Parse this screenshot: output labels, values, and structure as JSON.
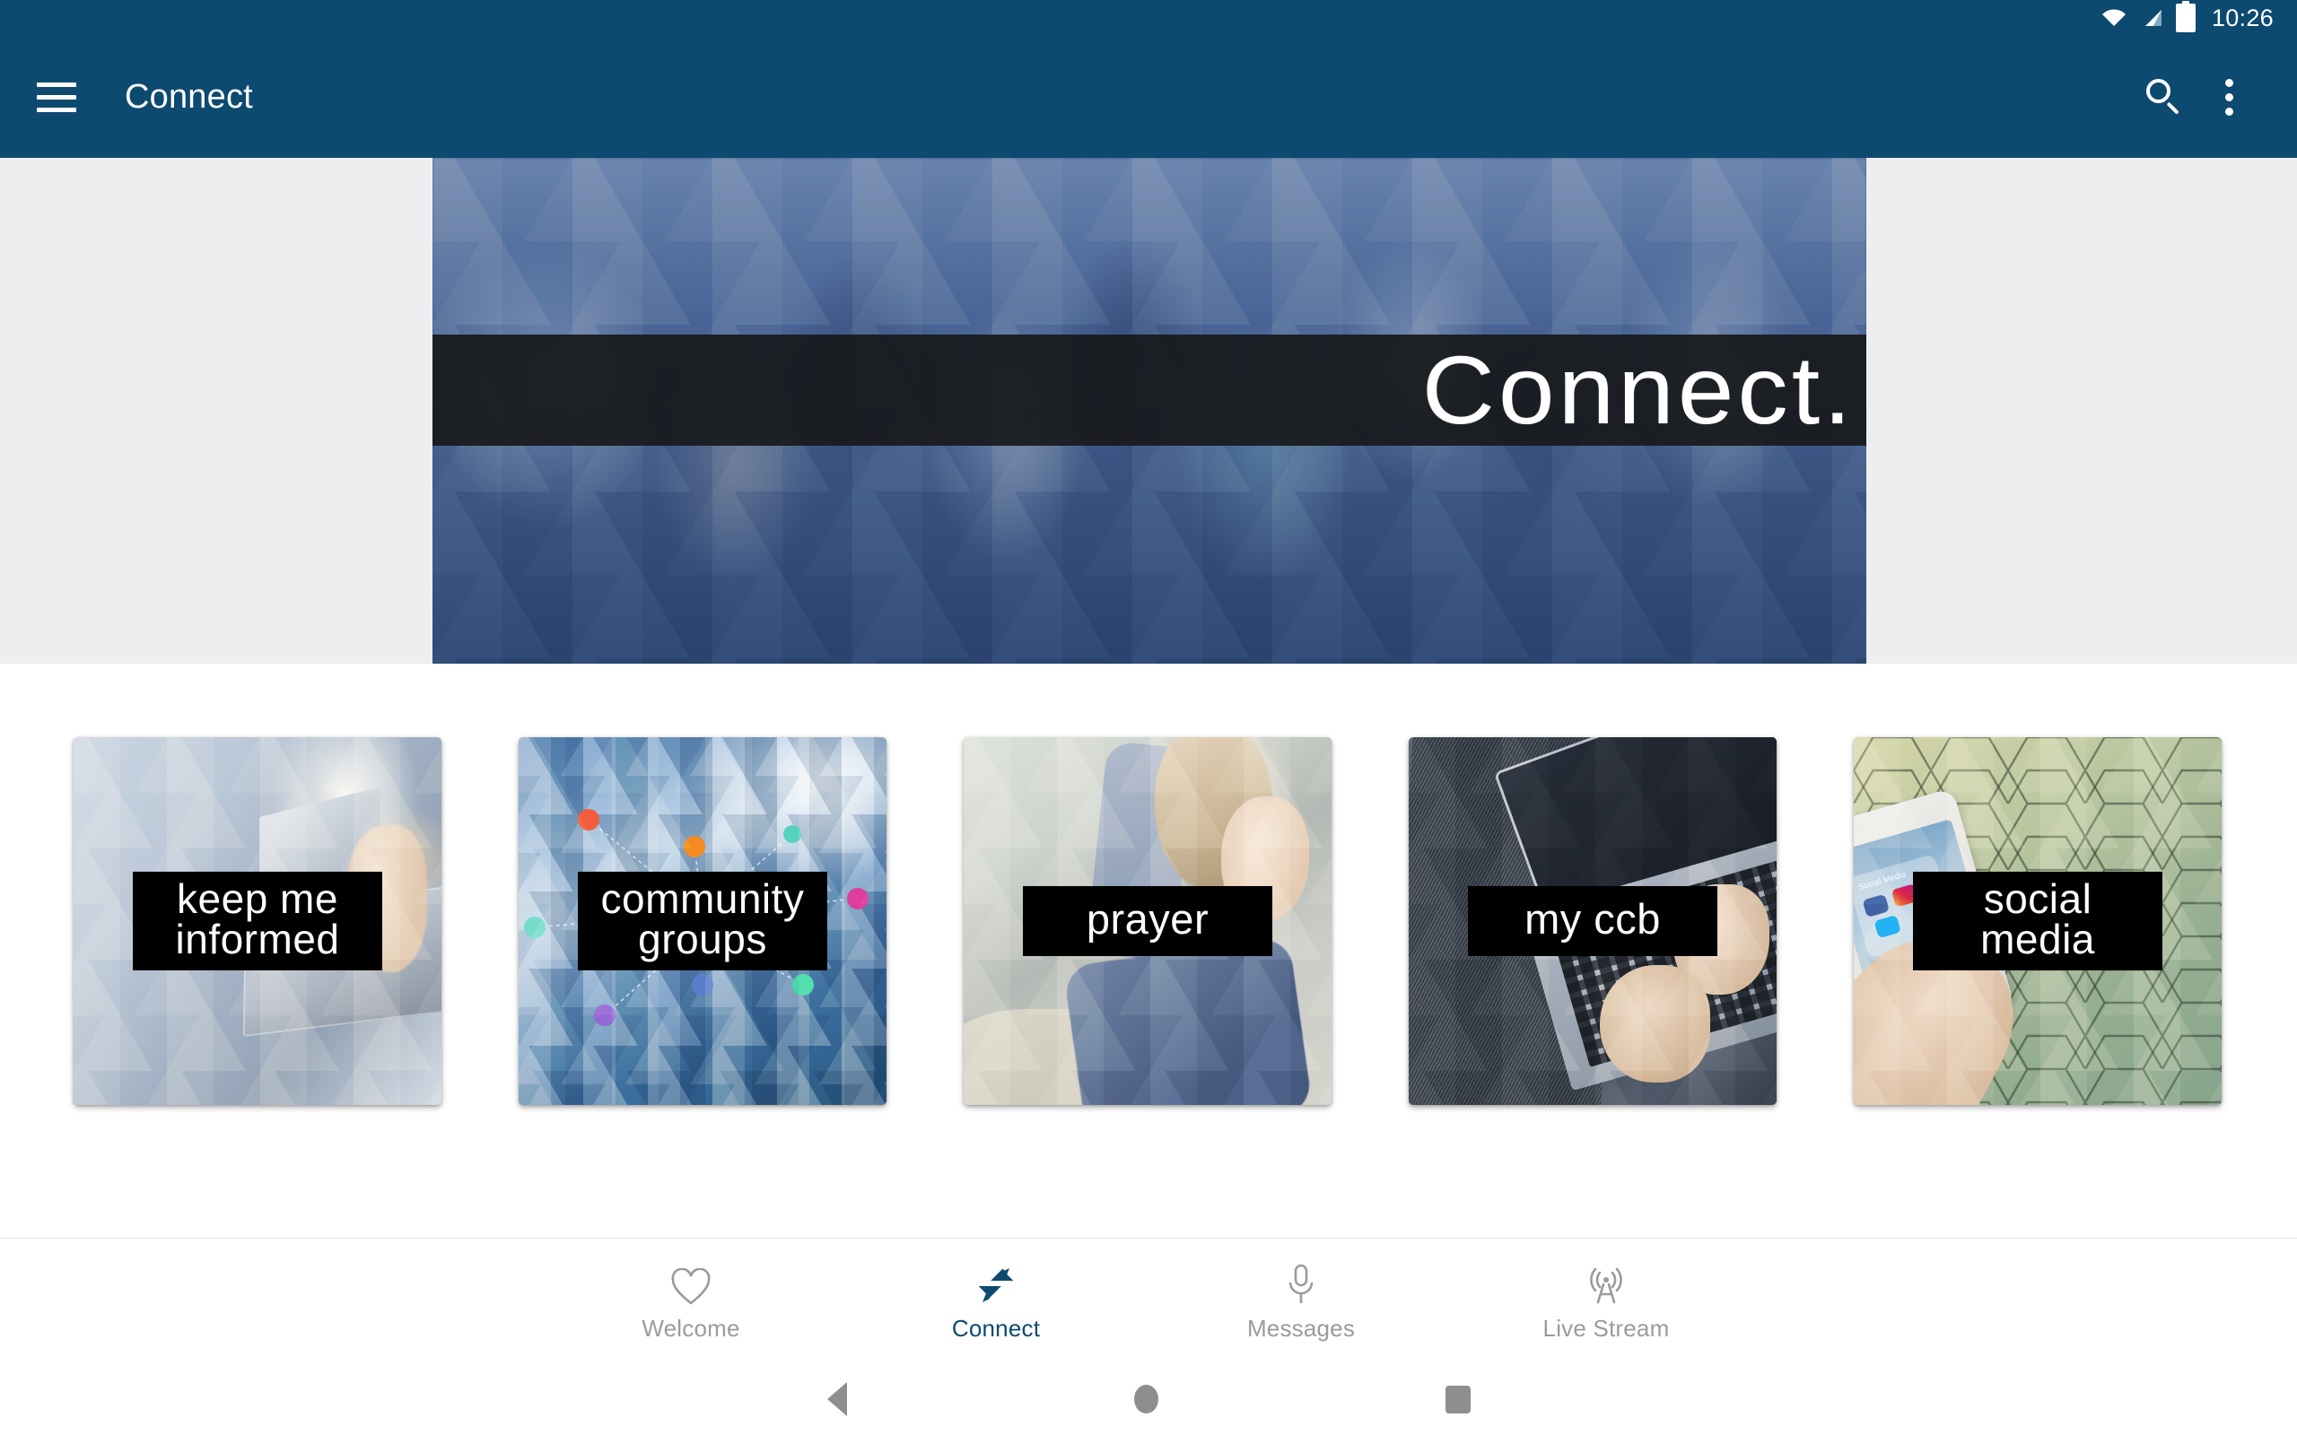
{
  "status_bar": {
    "time": "10:26",
    "icons": [
      "wifi-icon",
      "cellular-signal-icon",
      "battery-icon"
    ]
  },
  "toolbar": {
    "menu_icon": "hamburger-menu-icon",
    "title": "Connect",
    "search_icon": "search-icon",
    "overflow_icon": "overflow-menu-icon",
    "background_color": "#0d4a70"
  },
  "hero": {
    "banner_text": "Connect.",
    "image_description": "crowd of people gathering, blue tinted with geometric triangle overlay",
    "band_color": "#181a1c",
    "section_background": "#eceeef"
  },
  "cards": [
    {
      "label": "keep me\ninformed",
      "lines": 2,
      "image": "person-sitting-with-laptop"
    },
    {
      "label": "community\ngroups",
      "lines": 2,
      "image": "blue-triangle-mosaic-network-nodes"
    },
    {
      "label": "prayer",
      "lines": 1,
      "image": "woman-with-clasped-hands"
    },
    {
      "label": "my ccb",
      "lines": 1,
      "image": "hands-typing-on-laptop-on-carpet"
    },
    {
      "label": "social\nmedia",
      "lines": 2,
      "image": "hand-holding-phone-on-hex-tile"
    }
  ],
  "bottom_nav": {
    "active_color": "#0d4a70",
    "inactive_color": "#9b9b9b",
    "items": [
      {
        "label": "Welcome",
        "icon": "heart-icon",
        "active": false
      },
      {
        "label": "Connect",
        "icon": "connect-arrows-icon",
        "active": true
      },
      {
        "label": "Messages",
        "icon": "microphone-icon",
        "active": false
      },
      {
        "label": "Live Stream",
        "icon": "broadcast-tower-icon",
        "active": false
      }
    ]
  },
  "android_nav": {
    "back": "back-triangle-icon",
    "home": "home-circle-icon",
    "recents": "recents-square-icon"
  }
}
